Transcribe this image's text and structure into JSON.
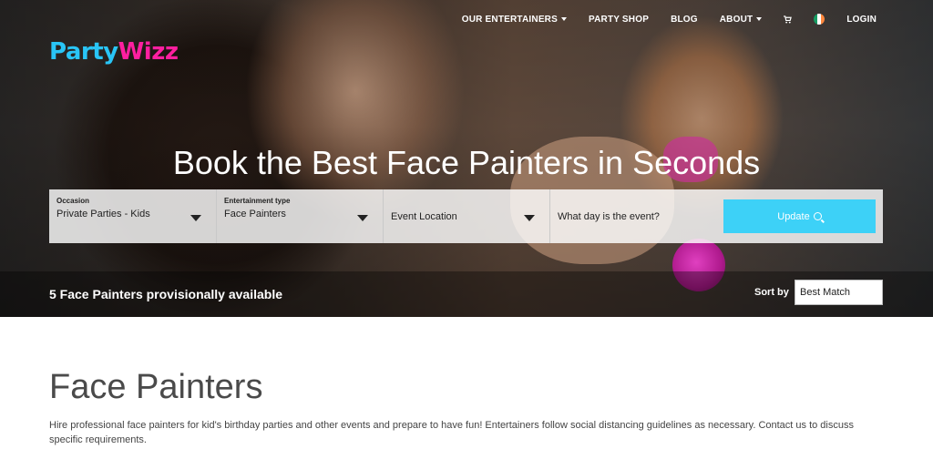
{
  "brand": {
    "part1": "Party",
    "part2": "Wizz",
    "colors": {
      "blue": "#29c5f6",
      "pink": "#ff1fa0"
    }
  },
  "nav": {
    "items": [
      {
        "label": "OUR ENTERTAINERS",
        "dropdown": true
      },
      {
        "label": "PARTY SHOP",
        "dropdown": false
      },
      {
        "label": "BLOG",
        "dropdown": false
      },
      {
        "label": "ABOUT",
        "dropdown": true
      }
    ],
    "cart_icon": "cart-icon",
    "flag_icon": "ireland-flag-icon",
    "login": "LOGIN"
  },
  "hero": {
    "headline": "Book the Best Face Painters in Seconds"
  },
  "search": {
    "occasion": {
      "label": "Occasion",
      "value": "Private Parties - Kids"
    },
    "entertainment_type": {
      "label": "Entertainment type",
      "value": "Face Painters"
    },
    "location": {
      "value": "Event Location"
    },
    "date": {
      "value": "What day is the event?"
    },
    "update_button": "Update",
    "accent": "#3dd1f7"
  },
  "results": {
    "count_text": "5 Face Painters provisionally available",
    "sort_label": "Sort by",
    "sort_value": "Best Match"
  },
  "main": {
    "title": "Face Painters",
    "intro": "Hire professional face painters for kid's birthday parties and other events and prepare to have fun! Entertainers follow social distancing guidelines as necessary. Contact us to discuss specific requirements."
  }
}
